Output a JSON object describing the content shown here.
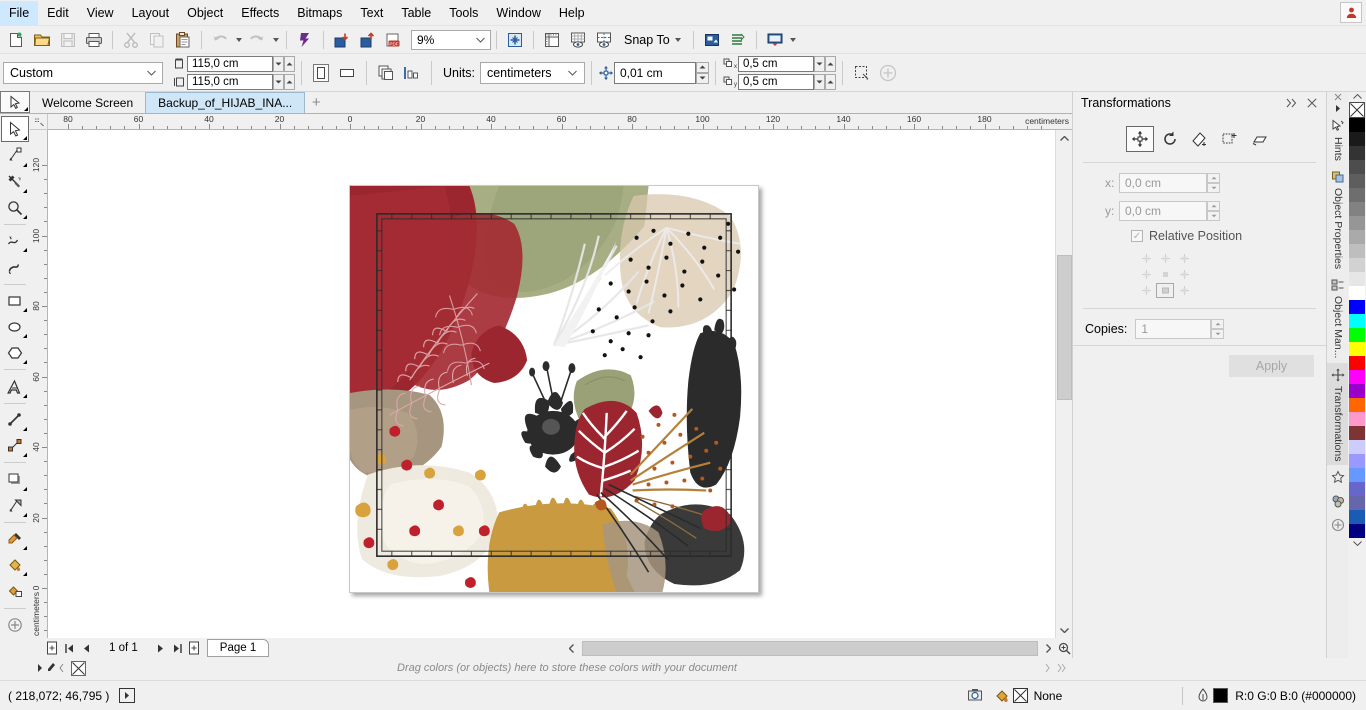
{
  "menubar": {
    "items": [
      {
        "label": "File",
        "accel": "F"
      },
      {
        "label": "Edit",
        "accel": "E"
      },
      {
        "label": "View",
        "accel": "V"
      },
      {
        "label": "Layout",
        "accel": "L"
      },
      {
        "label": "Object",
        "accel": "O"
      },
      {
        "label": "Effects",
        "accel": "c"
      },
      {
        "label": "Bitmaps",
        "accel": "B"
      },
      {
        "label": "Text",
        "accel": "x"
      },
      {
        "label": "Table",
        "accel": "T"
      },
      {
        "label": "Tools",
        "accel": "o"
      },
      {
        "label": "Window",
        "accel": "W"
      },
      {
        "label": "Help",
        "accel": "H"
      }
    ]
  },
  "toolbar": {
    "buttons": [
      {
        "name": "new-document-icon",
        "title": "New"
      },
      {
        "name": "open-document-icon",
        "title": "Open"
      },
      {
        "name": "save-document-icon",
        "title": "Save"
      },
      {
        "name": "print-icon",
        "title": "Print"
      },
      {
        "name": "cut-icon",
        "title": "Cut"
      },
      {
        "name": "copy-icon",
        "title": "Copy"
      },
      {
        "name": "paste-icon",
        "title": "Paste"
      },
      {
        "name": "undo-icon",
        "title": "Undo"
      },
      {
        "name": "redo-icon",
        "title": "Redo"
      },
      {
        "name": "corel-connect-icon",
        "title": "Search Content"
      },
      {
        "name": "import-icon",
        "title": "Import"
      },
      {
        "name": "export-icon",
        "title": "Export"
      },
      {
        "name": "publish-pdf-icon",
        "title": "Publish to PDF"
      }
    ],
    "zoom_level": "9%",
    "snap_to_label": "Snap To",
    "right_buttons": [
      {
        "name": "options-icon",
        "title": "Options"
      },
      {
        "name": "rulers-icon",
        "title": "Rulers"
      },
      {
        "name": "grid-icon",
        "title": "Grid"
      },
      {
        "name": "guidelines-icon",
        "title": "Guidelines"
      },
      {
        "name": "application-launcher-icon",
        "title": "Application Launcher"
      },
      {
        "name": "object-styles-icon",
        "title": "Object Styles"
      },
      {
        "name": "full-screen-preview-icon",
        "title": "Full-Screen Preview"
      }
    ]
  },
  "propertybar": {
    "page_preset": "Custom",
    "page_width": "115,0 cm",
    "page_height": "115,0 cm",
    "orientation_portrait": "portrait-icon",
    "orientation_landscape": "landscape-icon",
    "all_pages_icon": "all-pages-icon",
    "current_page_icon": "current-page-icon",
    "units_label": "Units:",
    "units_value": "centimeters",
    "nudge_value": "0,01 cm",
    "duplicate_x": "0,5 cm",
    "duplicate_y": "0,5 cm",
    "edit_page_icon": "edit-page-icon",
    "add_icon": "add-icon"
  },
  "doctabs": {
    "tabs": [
      {
        "label": "Welcome Screen",
        "active": false
      },
      {
        "label": "Backup_of_HIJAB_INA...",
        "active": true
      }
    ],
    "add_label": "+"
  },
  "toolbox": {
    "tools": [
      {
        "name": "pick-tool",
        "selected": true,
        "flyout": true
      },
      {
        "name": "shape-tool",
        "selected": false,
        "flyout": true
      },
      {
        "name": "crop-tool",
        "selected": false,
        "flyout": true
      },
      {
        "name": "zoom-tool",
        "selected": false,
        "flyout": true
      },
      {
        "name": "freehand-tool",
        "selected": false,
        "flyout": true
      },
      {
        "name": "artistic-media-tool",
        "selected": false,
        "flyout": false
      },
      {
        "name": "rectangle-tool",
        "selected": false,
        "flyout": true
      },
      {
        "name": "ellipse-tool",
        "selected": false,
        "flyout": true
      },
      {
        "name": "polygon-tool",
        "selected": false,
        "flyout": true
      },
      {
        "name": "text-tool",
        "selected": false,
        "flyout": true
      },
      {
        "name": "parallel-dimension-tool",
        "selected": false,
        "flyout": true
      },
      {
        "name": "straight-line-connector-tool",
        "selected": false,
        "flyout": true
      },
      {
        "name": "drop-shadow-tool",
        "selected": false,
        "flyout": true
      },
      {
        "name": "transparency-tool",
        "selected": false,
        "flyout": false
      },
      {
        "name": "color-eyedropper-tool",
        "selected": false,
        "flyout": true
      },
      {
        "name": "interactive-fill-tool",
        "selected": false,
        "flyout": true
      },
      {
        "name": "smart-fill-tool",
        "selected": false,
        "flyout": false
      },
      {
        "name": "quick-customize-icon",
        "selected": false,
        "flyout": false
      }
    ]
  },
  "rulers": {
    "unit_label": "centimeters",
    "horizontal_ticks": [
      "80",
      "60",
      "40",
      "20",
      "0",
      "20",
      "40",
      "60",
      "80",
      "100",
      "120",
      "140",
      "160",
      "180"
    ],
    "vertical_ticks": [
      "120",
      "100",
      "80",
      "60",
      "40",
      "20",
      "0"
    ]
  },
  "docker": {
    "title": "Transformations",
    "collapse_icon": "chevrons-right-icon",
    "close_icon": "close-icon",
    "mode_tabs": [
      {
        "name": "position-transform-tab",
        "selected": true
      },
      {
        "name": "rotate-transform-tab",
        "selected": false
      },
      {
        "name": "scale-mirror-transform-tab",
        "selected": false
      },
      {
        "name": "size-transform-tab",
        "selected": false
      },
      {
        "name": "skew-transform-tab",
        "selected": false
      }
    ],
    "x_label": "x:",
    "x_value": "0,0 cm",
    "y_label": "y:",
    "y_value": "0,0 cm",
    "relative_position_label": "Relative Position",
    "relative_position_checked": true,
    "copies_label": "Copies:",
    "copies_value": "1",
    "apply_label": "Apply",
    "apply_disabled": true
  },
  "vtabs": {
    "items": [
      {
        "label": "Hints",
        "icon": "hints-icon",
        "selected": false
      },
      {
        "label": "Object Properties",
        "icon": "object-properties-icon",
        "selected": false
      },
      {
        "label": "Object Man...",
        "icon": "object-manager-icon",
        "selected": false
      },
      {
        "label": "Transformations",
        "icon": "transformations-icon",
        "selected": true
      }
    ],
    "extra_icons": [
      {
        "name": "symbol-manager-icon"
      },
      {
        "name": "color-styles-icon"
      },
      {
        "name": "quick-customize-docker-icon"
      }
    ]
  },
  "colorpalette": {
    "none_swatch": "none-color-swatch",
    "swatches": [
      "#000000",
      "#1a1a1a",
      "#333333",
      "#4d4d4d",
      "#5e5e5e",
      "#6e6e6e",
      "#828282",
      "#969696",
      "#aaaaaa",
      "#bebebe",
      "#d2d2d2",
      "#e6e6e6",
      "#ffffff",
      "#0000ff",
      "#00ffff",
      "#00ff00",
      "#ffff00",
      "#ff0000",
      "#ff00ff",
      "#9900cc",
      "#ff6600",
      "#ff99cc",
      "#803333",
      "#ccccff",
      "#9999ff",
      "#6699ff",
      "#6666cc",
      "#6666aa",
      "#1a5bb5",
      "#000080"
    ],
    "scroll_up_icon": "palette-scroll-up-icon",
    "scroll_down_icon": "palette-scroll-down-icon"
  },
  "pagenav": {
    "add_page_start_icon": "add-page-icon",
    "first_icon": "first-page-icon",
    "prev_icon": "previous-page-icon",
    "count_label": "1 of 1",
    "next_icon": "next-page-icon",
    "last_icon": "last-page-icon",
    "add_page_end_icon": "add-page-icon",
    "page_tab_label": "Page 1"
  },
  "docpalette": {
    "hint": "Drag colors (or objects) here to store these colors with your document"
  },
  "statusbar": {
    "coordinates": "( 218,072; 46,795 )",
    "expand_icon": "expand-status-icon",
    "snapshot_icon": "document-snapshot-icon",
    "fill_icon": "fill-color-icon",
    "fill_value": "None",
    "outline_icon": "outline-pen-icon",
    "outline_color": "#000000",
    "outline_value": "R:0 G:0 B:0 (#000000)"
  },
  "artwork": {
    "title": "floral-tropical-hijab-scarf-design",
    "palette": {
      "crimson": "#a42b33",
      "deep_red": "#9c2630",
      "sage": "#a8ae84",
      "olive": "#9aa177",
      "tan": "#a6957f",
      "cream": "#efeade",
      "gold": "#c99a3f",
      "mustard": "#d6a84a",
      "charcoal": "#3a3a3a",
      "black": "#1c1c1c",
      "beige": "#d8c7ae",
      "white": "#ffffff",
      "rust": "#b5581f"
    }
  }
}
